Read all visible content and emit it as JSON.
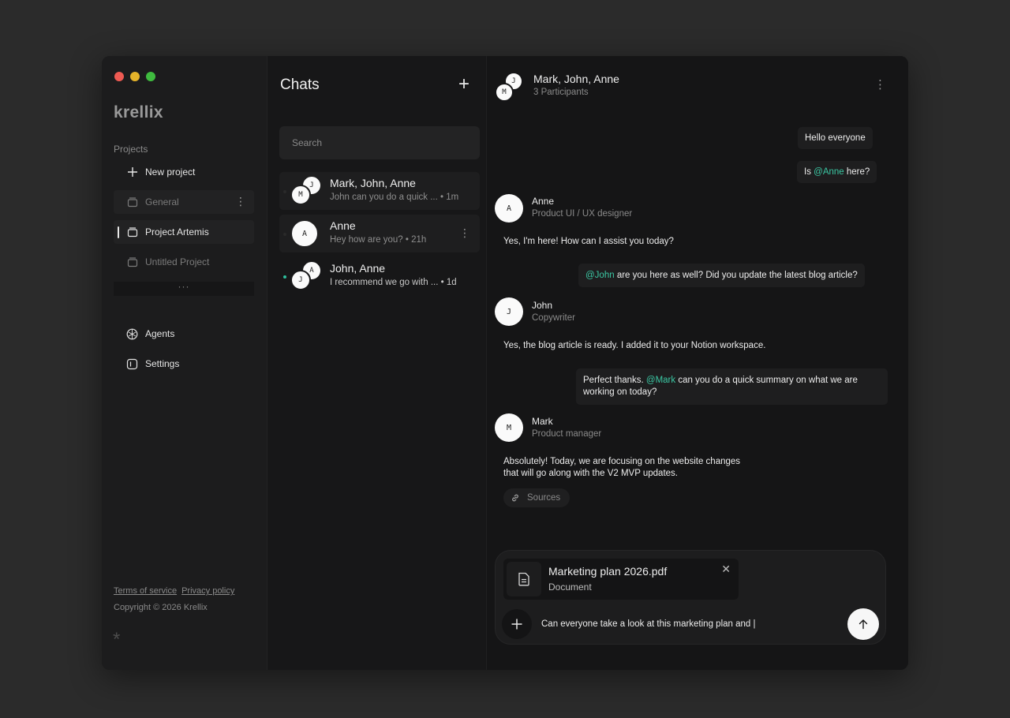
{
  "sidebar": {
    "logo": "krellix",
    "projects_label": "Projects",
    "new_project": "New project",
    "items": [
      {
        "label": "General"
      },
      {
        "label": "Project Artemis"
      },
      {
        "label": "Untitled Project"
      }
    ],
    "more": "···",
    "agents": "Agents",
    "settings": "Settings",
    "terms": "Terms of service",
    "privacy": "Privacy policy",
    "copyright": "Copyright © 2026 Krellix",
    "asterisk": "*"
  },
  "chats": {
    "title": "Chats",
    "add": "+",
    "search_placeholder": "Search",
    "list": [
      {
        "name": "Mark, John, Anne",
        "preview": "John can you do a quick ... • 1m",
        "avatar_back": "J",
        "avatar_front": "M"
      },
      {
        "name": "Anne",
        "preview": "Hey how are you? • 21h",
        "avatar": "A"
      },
      {
        "name": "John, Anne",
        "preview": "I recommend we go with ... • 1d",
        "avatar_back": "A",
        "avatar_front": "J"
      }
    ]
  },
  "conversation": {
    "title": "Mark, John, Anne",
    "participants": "3 Participants",
    "avatar_back": "J",
    "avatar_front": "M",
    "messages": {
      "m1": "Hello everyone",
      "m2_pre": "Is ",
      "m2_mention": "@Anne",
      "m2_post": " here?",
      "anne_initial": "A",
      "anne_name": "Anne",
      "anne_role": "Product UI / UX designer",
      "anne_reply": "Yes, I'm here! How can I assist you today?",
      "m3_mention": "@John",
      "m3_text": " are you here as well? Did you update the latest blog article?",
      "john_initial": "J",
      "john_name": "John",
      "john_role": "Copywriter",
      "john_reply": "Yes, the blog article is ready. I added it to your Notion workspace.",
      "m4_pre": "Perfect thanks. ",
      "m4_mention": "@Mark",
      "m4_post_line1": " can you do a quick summary on what we are",
      "m4_line2": "working on today?",
      "mark_initial": "M",
      "mark_name": "Mark",
      "mark_role": "Product manager",
      "mark_reply_line1": "Absolutely! Today, we are focusing on the website changes",
      "mark_reply_line2": "that will go along with the V2 MVP updates.",
      "sources": "Sources"
    },
    "composer": {
      "file_name": "Marketing plan 2026.pdf",
      "file_type": "Document",
      "input_value": "Can everyone take a look at this marketing plan and |"
    }
  },
  "colors": {
    "accent_mention": "#3bc8a4",
    "online": "#2dbd9b"
  }
}
